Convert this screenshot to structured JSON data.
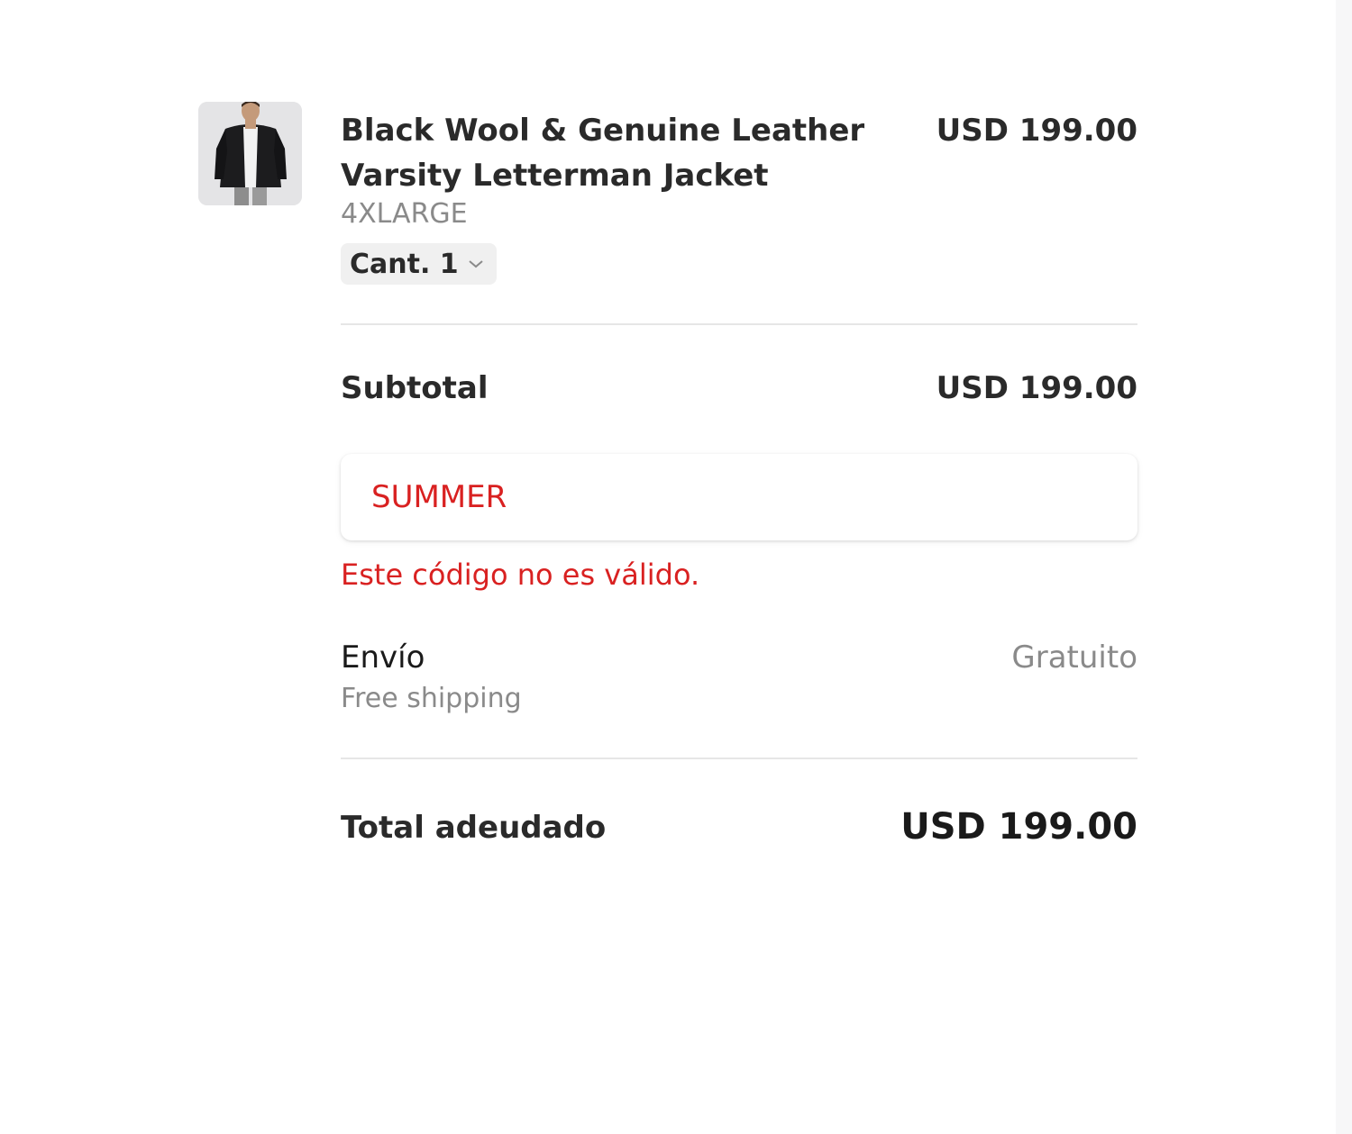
{
  "item": {
    "title": "Black Wool & Genuine Leather Varsity Letterman Jacket",
    "price": "USD 199.00",
    "variant": "4XLARGE",
    "quantity_label": "Cant. 1",
    "thumbnail_icon": "product-photo-jacket"
  },
  "subtotal": {
    "label": "Subtotal",
    "value": "USD 199.00"
  },
  "coupon": {
    "value": "SUMMER",
    "error": "Este código no es válido."
  },
  "shipping": {
    "label": "Envío",
    "method": "Free shipping",
    "value": "Gratuito"
  },
  "total": {
    "label": "Total adeudado",
    "value": "USD 199.00"
  },
  "colors": {
    "error": "#d92121",
    "muted": "#8a8a8a",
    "text": "#2a2a2a"
  }
}
